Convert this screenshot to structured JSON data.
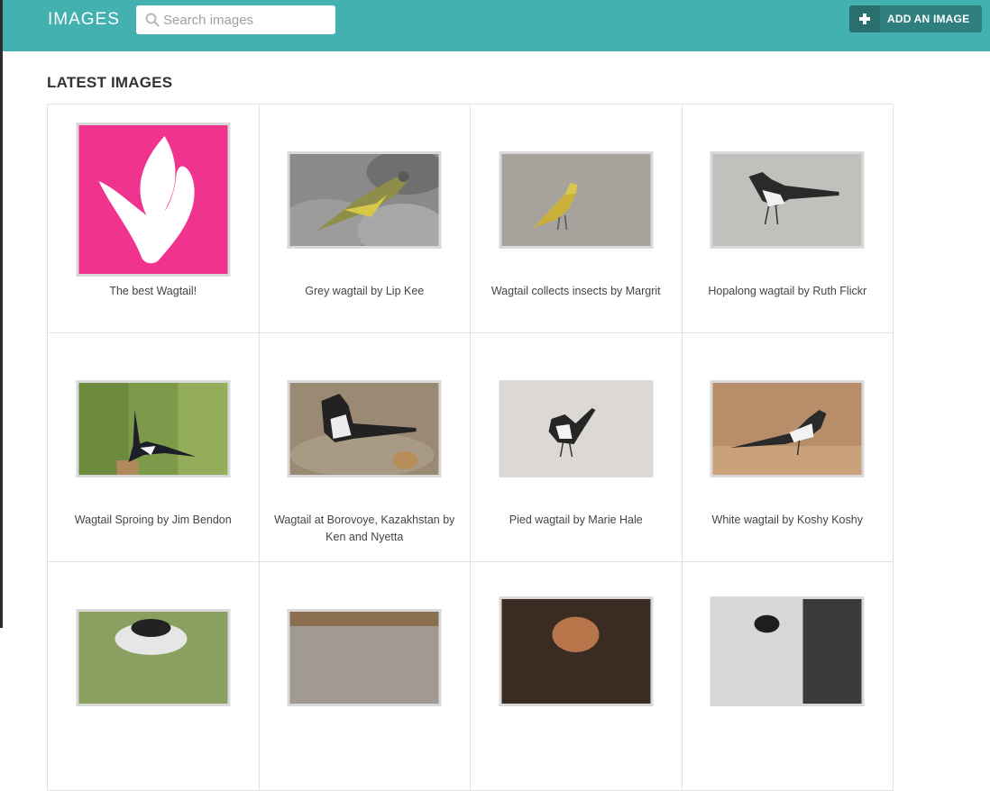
{
  "header": {
    "title": "IMAGES",
    "search_placeholder": "Search images",
    "add_button_label": "ADD AN IMAGE"
  },
  "main": {
    "section_title": "LATEST IMAGES",
    "images": [
      {
        "caption": "The best Wagtail!"
      },
      {
        "caption": "Grey wagtail by Lip Kee"
      },
      {
        "caption": "Wagtail collects insects by Margrit"
      },
      {
        "caption": "Hopalong wagtail by Ruth Flickr"
      },
      {
        "caption": "Wagtail Sproing by Jim Bendon"
      },
      {
        "caption": "Wagtail at Borovoye, Kazakhstan by Ken and Nyetta"
      },
      {
        "caption": "Pied wagtail by Marie Hale"
      },
      {
        "caption": "White wagtail by Koshy Koshy"
      },
      {
        "caption": ""
      },
      {
        "caption": ""
      },
      {
        "caption": ""
      },
      {
        "caption": ""
      }
    ]
  },
  "colors": {
    "header_bg": "#43b1b0",
    "button_bg": "#2f7f7f",
    "logo_bg": "#f0338d"
  }
}
